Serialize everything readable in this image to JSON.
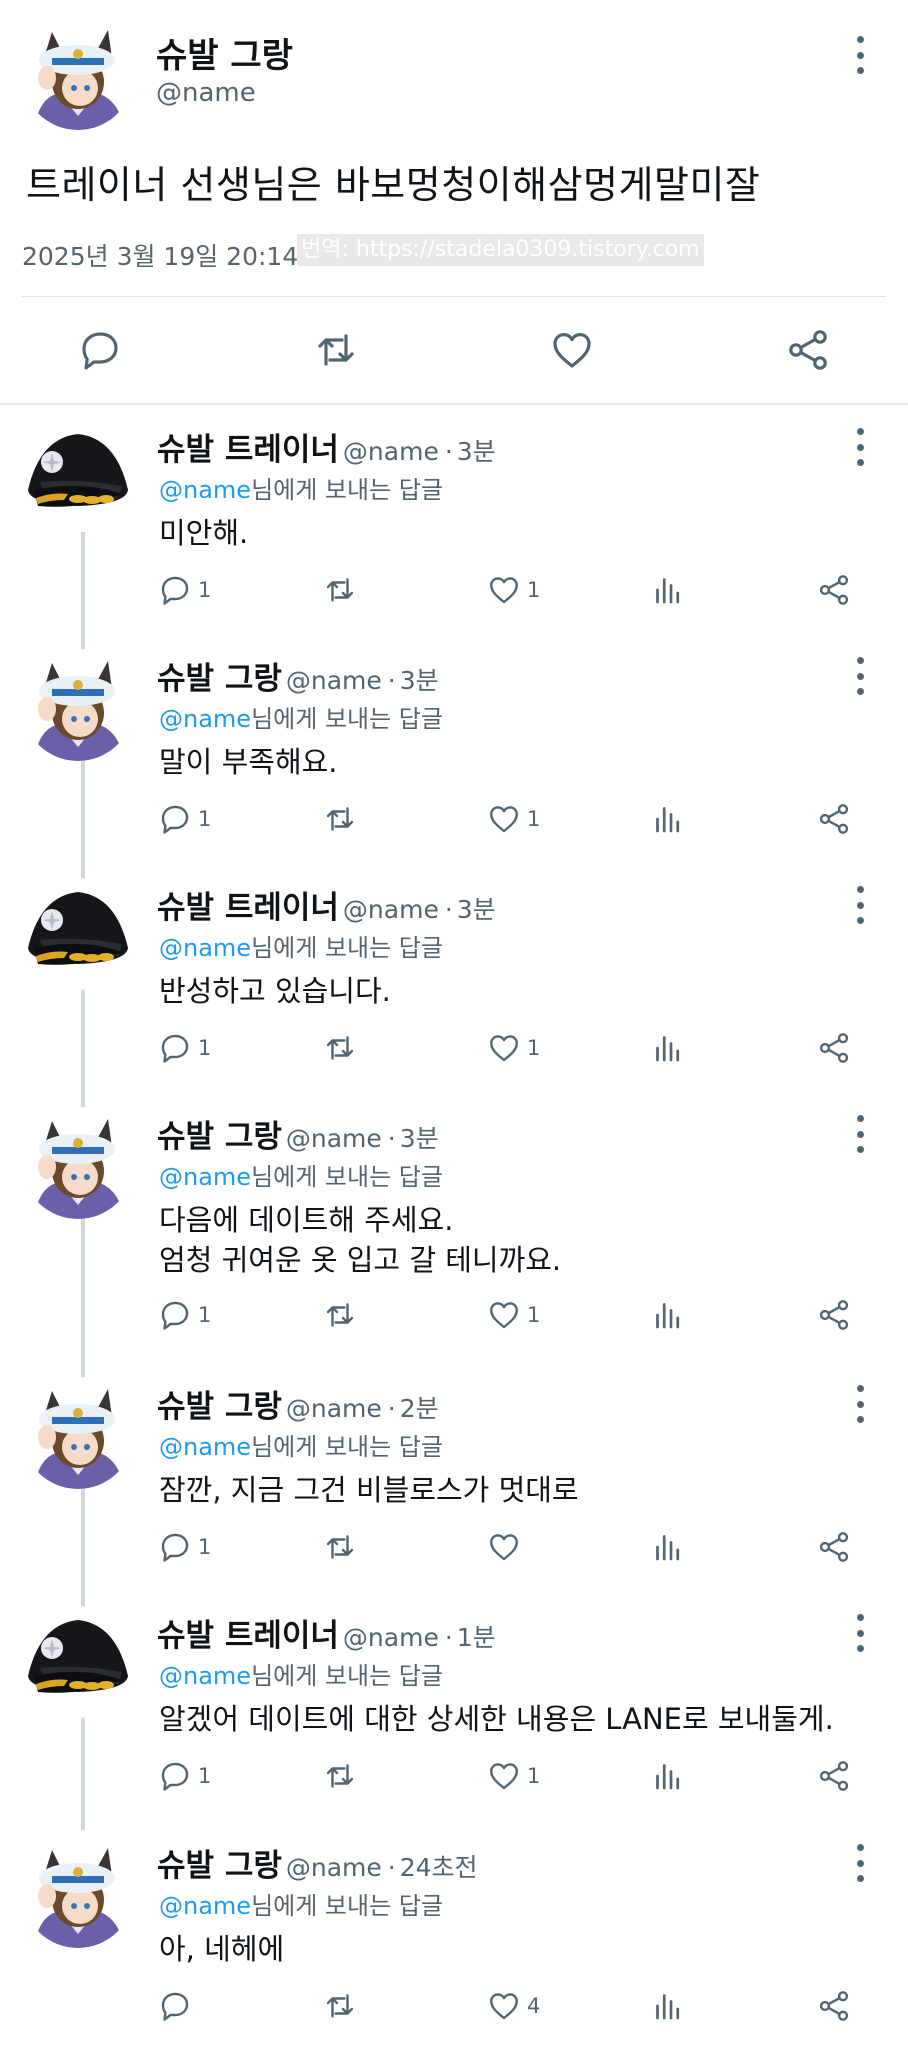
{
  "main_tweet": {
    "display_name": "슈발 그랑",
    "handle": "@name",
    "text": "트레이너 선생님은 바보멍청이해삼멍게말미잘",
    "date": "2025년 3월 19일  20:14",
    "translate_watermark": "번역: https://stadela0309.tistory.com",
    "icons": [
      "reply-icon",
      "retweet-icon",
      "like-icon",
      "share-icon"
    ]
  },
  "replies": [
    {
      "display_name": "슈발 트레이너",
      "handle": "@name",
      "time": "3분",
      "reply_prefix": "@name",
      "reply_suffix": "님에게 보내는 답글",
      "text": "미안해.",
      "reply_count": "1",
      "like_count": "1"
    },
    {
      "display_name": "슈발 그랑",
      "handle": "@name",
      "time": "3분",
      "reply_prefix": "@name",
      "reply_suffix": "님에게 보내는 답글",
      "text": "말이 부족해요.",
      "reply_count": "1",
      "like_count": "1"
    },
    {
      "display_name": "슈발 트레이너",
      "handle": "@name",
      "time": "3분",
      "reply_prefix": "@name",
      "reply_suffix": "님에게 보내는 답글",
      "text": "반성하고 있습니다.",
      "reply_count": "1",
      "like_count": "1"
    },
    {
      "display_name": "슈발 그랑",
      "handle": "@name",
      "time": "3분",
      "reply_prefix": "@name",
      "reply_suffix": "님에게 보내는 답글",
      "text": "다음에 데이트해 주세요.\n엄청 귀여운 옷 입고 갈 테니까요.",
      "reply_count": "1",
      "like_count": "1"
    },
    {
      "display_name": "슈발 그랑",
      "handle": "@name",
      "time": "2분",
      "reply_prefix": "@name",
      "reply_suffix": "님에게 보내는 답글",
      "text": "잠깐, 지금 그건 비블로스가 멋대로",
      "reply_count": "1",
      "like_count": ""
    },
    {
      "display_name": "슈발 트레이너",
      "handle": "@name",
      "time": "1분",
      "reply_prefix": "@name",
      "reply_suffix": "님에게 보내는 답글",
      "text": "알겠어 데이트에 대한 상세한 내용은 LANE로 보내둘게.",
      "reply_count": "1",
      "like_count": "1"
    },
    {
      "display_name": "슈발 그랑",
      "handle": "@name",
      "time": "24초전",
      "reply_prefix": "@name",
      "reply_suffix": "님에게 보내는 답글",
      "text": "아, 네헤에",
      "reply_count": "",
      "like_count": "4"
    }
  ],
  "reply_avatar_types": [
    "trainer",
    "grand",
    "trainer",
    "grand",
    "grand",
    "trainer",
    "grand"
  ],
  "colors": {
    "mention": "#1d9bf0",
    "secondary_text": "#536471",
    "thread_line": "#cfd9de"
  }
}
